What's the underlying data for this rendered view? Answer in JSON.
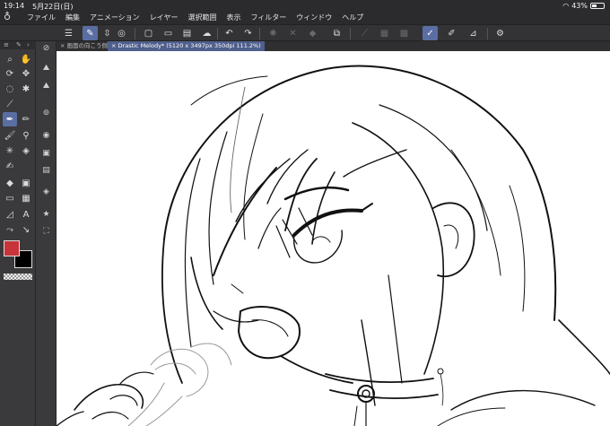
{
  "status": {
    "time": "19:14",
    "date": "5月22日(日)",
    "battery": "43%",
    "battery_level": 0.43
  },
  "menu": [
    "ファイル",
    "編集",
    "アニメーション",
    "レイヤー",
    "選択範囲",
    "表示",
    "フィルター",
    "ウィンドウ",
    "ヘルプ"
  ],
  "tabs": {
    "inactive_label": "画面の向こう側",
    "active_label": "Drastic Melody* (5120 x 3497px 350dpi 111.2%)"
  },
  "colors": {
    "main_color": "#c8343a",
    "sub_color": "#000000",
    "accent": "#5b6ea3"
  },
  "icons": {
    "tools": [
      "magnifier",
      "hand",
      "move",
      "rotate",
      "lasso",
      "magic-wand",
      "eyedropper",
      "pen",
      "pencil",
      "brush",
      "airbrush",
      "decoration",
      "eraser",
      "blend",
      "fill",
      "gradient",
      "figure",
      "text",
      "frame",
      "balloon",
      "correction-line"
    ]
  }
}
